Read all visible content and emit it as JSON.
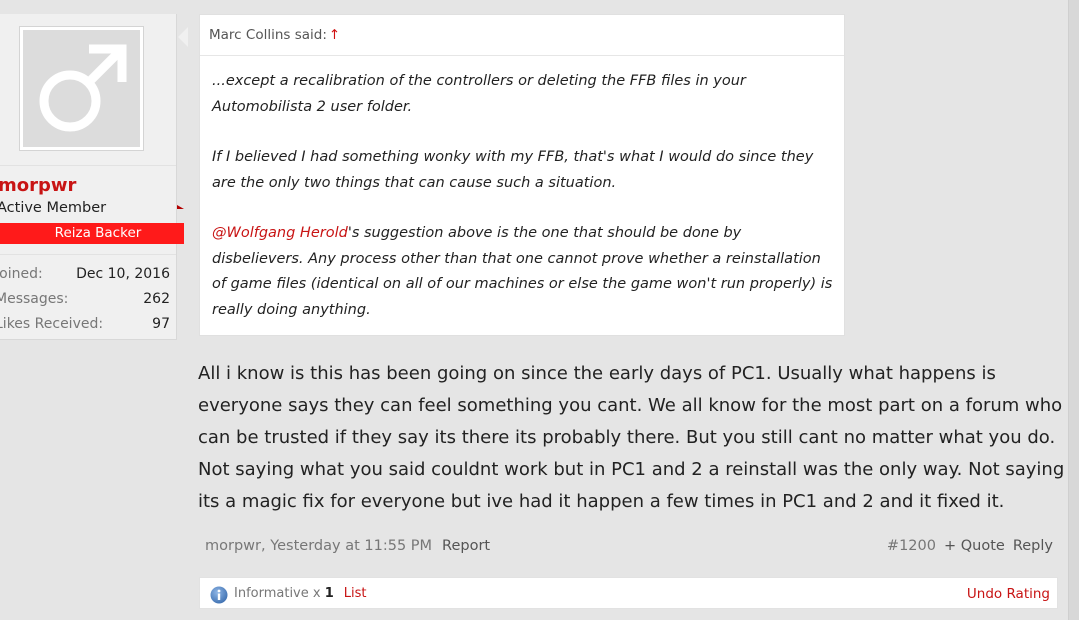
{
  "user": {
    "name": "morpwr",
    "title": "Active Member",
    "banner": "Reiza Backer",
    "stats": [
      {
        "label": "Joined:",
        "value": "Dec 10, 2016"
      },
      {
        "label": "Messages:",
        "value": "262"
      },
      {
        "label": "Likes Received:",
        "value": "97"
      }
    ],
    "avatar_icon": "male-symbol-icon"
  },
  "quote": {
    "author_label": "Marc Collins said:",
    "jump_glyph": "↑",
    "para1": "...except a recalibration of the controllers or deleting the FFB files in your Automobilista 2 user folder.",
    "para2": "If I believed I had something wonky with my FFB, that's what I would do since they are the only two things that can cause such a situation.",
    "mention": "@Wolfgang Herold",
    "para3_rest": "'s suggestion above is the one that should be done by disbelievers. Any process other than that one cannot prove whether a reinstallation of game files (identical on all of our machines or else the game won't run properly) is really doing anything."
  },
  "message": {
    "text": "All i know is this has been going on since the early days of PC1. Usually what happens is everyone says they can feel something you cant. We all know for the most part on a forum who can be trusted if they say its there its probably there. But you still cant no matter what you do. Not saying what you said couldnt work but in PC1 and 2 a reinstall was the only way. Not saying its a magic fix for everyone but ive had it happen a few times in PC1 and 2 and it fixed it."
  },
  "meta": {
    "author_time": "morpwr, Yesterday at 11:55 PM",
    "report": "Report",
    "permalink": "#1200",
    "quote": "+ Quote",
    "reply": "Reply"
  },
  "ratings": {
    "label": "Informative",
    "times": "x",
    "count": "1",
    "list": "List",
    "undo": "Undo Rating",
    "icon": "info-icon"
  },
  "colors": {
    "accent": "#c81414",
    "banner": "#ff1a1a",
    "background": "#e5e5e5"
  }
}
